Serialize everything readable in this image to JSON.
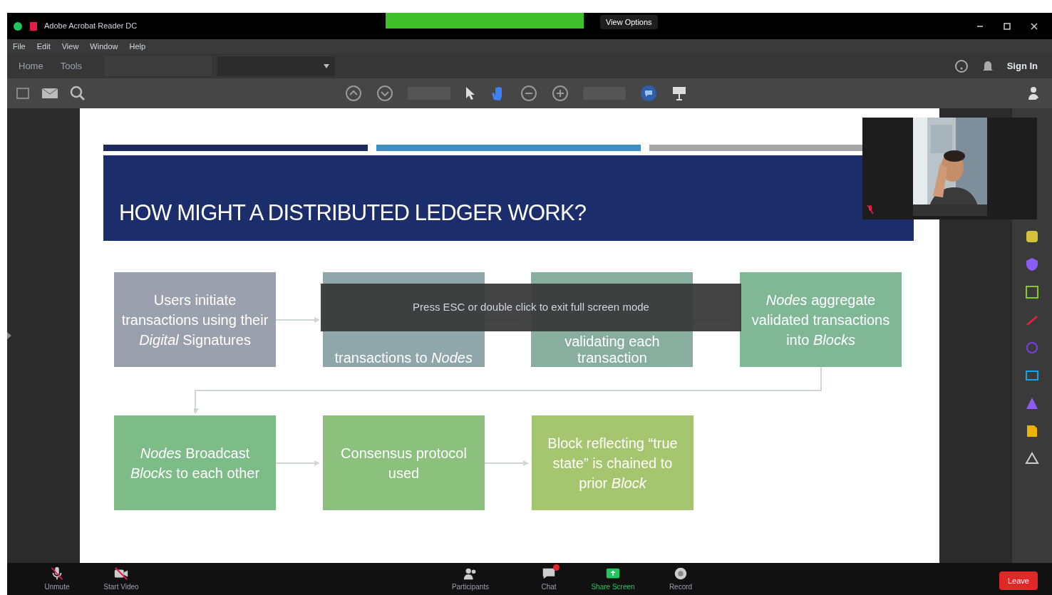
{
  "window": {
    "title": "Adobe Acrobat Reader DC",
    "view_options": "View Options"
  },
  "menu": [
    "File",
    "Edit",
    "View",
    "Window",
    "Help"
  ],
  "nav_tabs": [
    "Home",
    "Tools"
  ],
  "account": {
    "sign_in": "Sign In"
  },
  "toast": "Press ESC or double click to exit full screen mode",
  "slide": {
    "title": "HOW MIGHT A DISTRIBUTED LEDGER WORK?",
    "bars": [
      {
        "color": "#1c2a5e"
      },
      {
        "color": "#3f8fc4"
      },
      {
        "color": "#a6a6a6"
      }
    ],
    "steps": [
      {
        "text": "Users initiate transactions using their *Digital* Signatures",
        "color": "#9aa0ad"
      },
      {
        "text": "transactions to *Nodes*",
        "color": "#8fa7ab"
      },
      {
        "text": "validating each transaction",
        "color": "#87ae9f"
      },
      {
        "text": "*Nodes* aggregate validated transactions into *Blocks*",
        "color": "#80b896"
      },
      {
        "text": "*Nodes* Broadcast *Blocks* to each other",
        "color": "#7dbb87"
      },
      {
        "text": "Consensus protocol used",
        "color": "#8cc17d"
      },
      {
        "text": "Block reflecting “true state” is chained to prior *Block*",
        "color": "#a5c56e"
      }
    ]
  },
  "meeting_controls": [
    {
      "kind": "mic",
      "label": "Unmute",
      "active": false,
      "unread": false
    },
    {
      "kind": "video",
      "label": "Start Video",
      "active": false,
      "unread": false
    },
    {
      "kind": "participants",
      "label": "Participants",
      "active": false,
      "unread": false
    },
    {
      "kind": "chat",
      "label": "Chat",
      "active": false,
      "unread": true
    },
    {
      "kind": "share",
      "label": "Share Screen",
      "active": true,
      "unread": false
    },
    {
      "kind": "record",
      "label": "Record",
      "active": false,
      "unread": false
    }
  ],
  "leave": "Leave"
}
